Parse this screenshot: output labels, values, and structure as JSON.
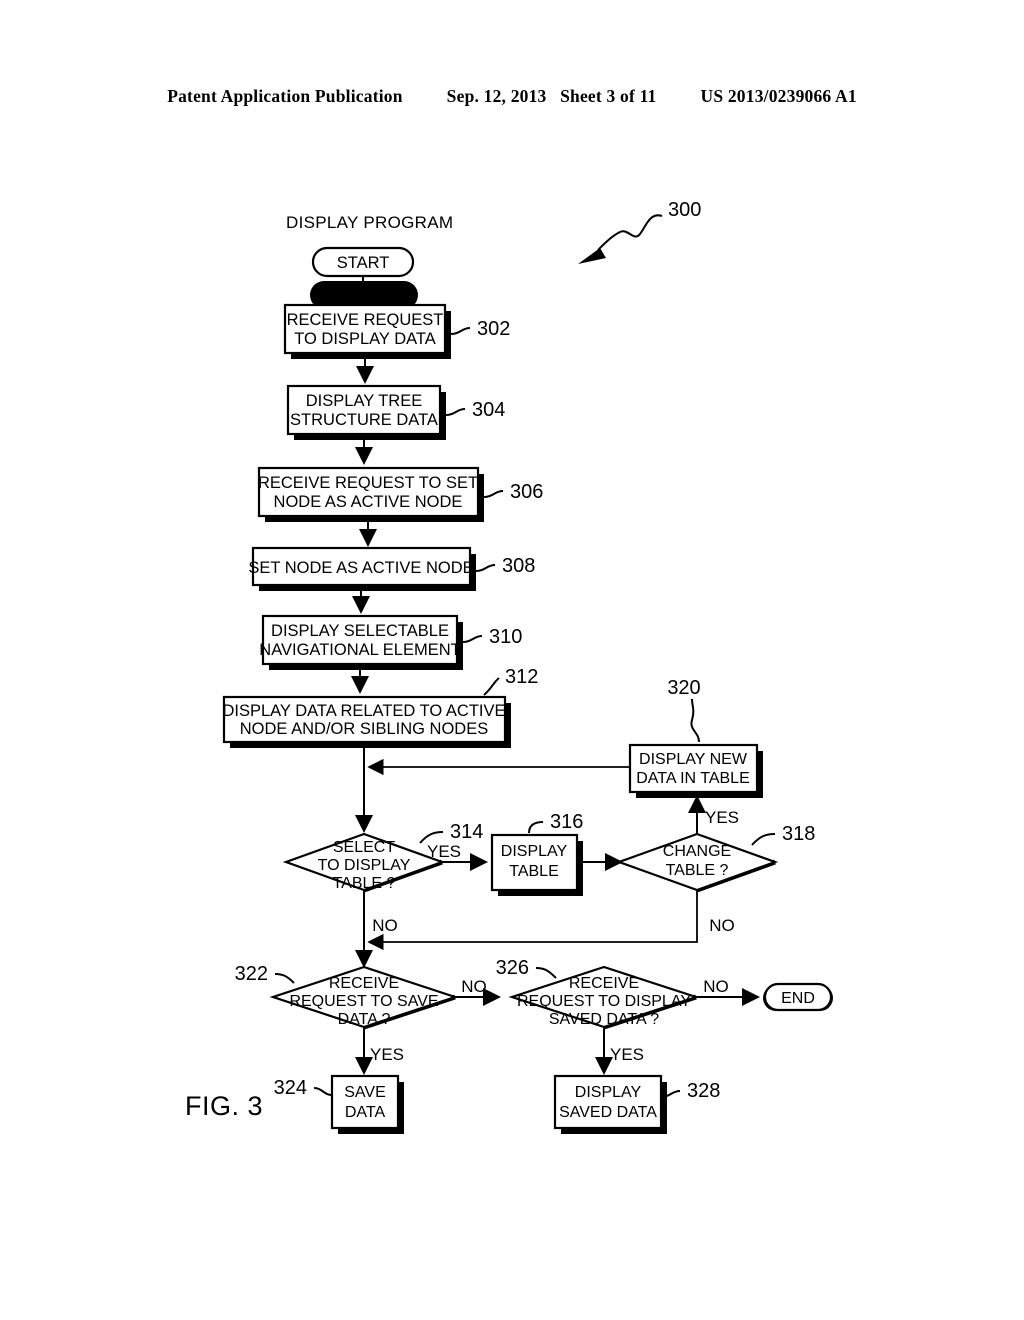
{
  "header": {
    "publication": "Patent Application Publication",
    "date": "Sep. 12, 2013",
    "sheet": "Sheet 3 of 11",
    "number": "US 2013/0239066 A1"
  },
  "figure": {
    "label": "FIG. 3",
    "diagram_title": "DISPLAY PROGRAM",
    "diagram_ref": "300"
  },
  "nodes": {
    "start": {
      "label": "START"
    },
    "end": {
      "label": "END"
    },
    "n302": {
      "line1": "RECEIVE REQUEST",
      "line2": "TO DISPLAY DATA",
      "ref": "302"
    },
    "n304": {
      "line1": "DISPLAY TREE",
      "line2": "STRUCTURE DATA",
      "ref": "304"
    },
    "n306": {
      "line1": "RECEIVE REQUEST TO SET",
      "line2": "NODE AS ACTIVE NODE",
      "ref": "306"
    },
    "n308": {
      "line1": "SET NODE AS ACTIVE NODE",
      "ref": "308"
    },
    "n310": {
      "line1": "DISPLAY SELECTABLE",
      "line2": "NAVIGATIONAL ELEMENT",
      "ref": "310"
    },
    "n312": {
      "line1": "DISPLAY DATA RELATED TO ACTIVE",
      "line2": "NODE AND/OR SIBLING NODES",
      "ref": "312"
    },
    "n314": {
      "line1": "SELECT",
      "line2": "TO DISPLAY",
      "line3": "TABLE ?",
      "ref": "314"
    },
    "n316": {
      "line1": "DISPLAY",
      "line2": "TABLE",
      "ref": "316"
    },
    "n318": {
      "line1": "CHANGE",
      "line2": "TABLE ?",
      "ref": "318"
    },
    "n320": {
      "line1": "DISPLAY NEW",
      "line2": "DATA IN TABLE",
      "ref": "320"
    },
    "n322": {
      "line1": "RECEIVE",
      "line2": "REQUEST TO SAVE",
      "line3": "DATA ?",
      "ref": "322"
    },
    "n324": {
      "line1": "SAVE",
      "line2": "DATA",
      "ref": "324"
    },
    "n326": {
      "line1": "RECEIVE",
      "line2": "REQUEST TO DISPLAY",
      "line3": "SAVED DATA ?",
      "ref": "326"
    },
    "n328": {
      "line1": "DISPLAY",
      "line2": "SAVED DATA",
      "ref": "328"
    }
  },
  "edge_labels": {
    "yes_314": "YES",
    "no_314": "NO",
    "yes_318": "YES",
    "no_318": "NO",
    "yes_322": "YES",
    "no_322": "NO",
    "yes_326": "YES",
    "no_326": "NO"
  },
  "colors": {
    "ink": "#000000",
    "paper": "#ffffff"
  }
}
